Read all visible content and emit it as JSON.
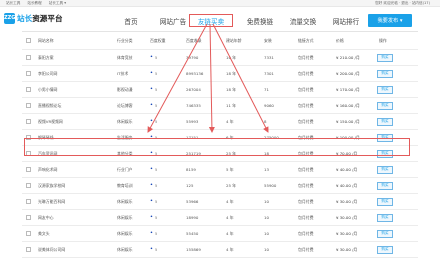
{
  "topbar": {
    "links": [
      "站长工具",
      "站长教程",
      "站长工具 ▾"
    ],
    "right_text": "您好 欢迎光临 · 退出 · 站内信(17)"
  },
  "logo": {
    "badge": "ZZG",
    "name_blue": "站长",
    "name_black": "资源平台"
  },
  "nav": [
    "首页",
    "网站广告",
    "友链买卖",
    "免费换链",
    "流量交换",
    "网站排行"
  ],
  "nav_active_index": 2,
  "main_button": "我要发布 ▾",
  "table": {
    "columns": [
      "网站名称",
      "行业分类",
      "百度权重",
      "百度收录",
      "建站年龄",
      "安装",
      "链接方式",
      "价格",
      "操作"
    ],
    "rows": [
      [
        "泰阳方案",
        "体育竞技",
        "5",
        "39790",
        "10 年",
        "7331",
        "包月付费",
        "¥ 210.00 /月",
        "购买"
      ],
      [
        "李阳公司网",
        "IT技术",
        "5",
        "8993136",
        "18 年",
        "7301",
        "包月付费",
        "¥ 200.00 /月",
        "购买"
      ],
      [
        "小男小情网",
        "影视动漫",
        "5",
        "267004",
        "18 年",
        "71",
        "包月付费",
        "¥ 170.00 /月",
        "购买"
      ],
      [
        "直播视频论坛",
        "论坛博客",
        "5",
        "746335",
        "11 年",
        "9060",
        "包月付费",
        "¥ 160.00 /月",
        "购买"
      ],
      [
        "视频VR视频网",
        "休闲娱乐",
        "5",
        "55993",
        "4 年",
        "8",
        "包月付费",
        "¥ 150.00 /月",
        "购买"
      ],
      [
        "钢琴琴线",
        "生活服务",
        "5",
        "17151",
        "6 年",
        "275000",
        "包月付费",
        "¥ 100.00 /月",
        "购买"
      ],
      [
        "汽车资讯网",
        "其他分类",
        "5",
        "251719",
        "25 年",
        "18",
        "包月付费",
        "¥ 70.00 /月",
        "购买"
      ],
      [
        "声响化术网",
        "行业门户",
        "5",
        "8159",
        "5 年",
        "13",
        "包月付费",
        "¥ 40.00 /月",
        "购买"
      ],
      [
        "汉源家族学校网",
        "教育培训",
        "5",
        "125",
        "25 年",
        "55900",
        "包月付费",
        "¥ 40.00 /月",
        "购买"
      ],
      [
        "光琳万能百科网",
        "休闲娱乐",
        "5",
        "53966",
        "4 年",
        "10",
        "包月付费",
        "¥ 30.00 /月",
        "购买"
      ],
      [
        "网友中心",
        "休闲娱乐",
        "5",
        "18990",
        "4 年",
        "10",
        "包月付费",
        "¥ 30.00 /月",
        "购买"
      ],
      [
        "美文头",
        "休闲娱乐",
        "5",
        "55450",
        "4 年",
        "10",
        "包月付费",
        "¥ 30.00 /月",
        "购买"
      ],
      [
        "说美体问公司网",
        "休闲娱乐",
        "5",
        "155869",
        "4 年",
        "10",
        "包月付费",
        "¥ 30.00 /月",
        "购买"
      ]
    ],
    "highlight_row_index": 5
  },
  "colors": {
    "accent": "#1aa1e8",
    "highlight": "#e35a5a",
    "weight": "#1a49b8"
  }
}
